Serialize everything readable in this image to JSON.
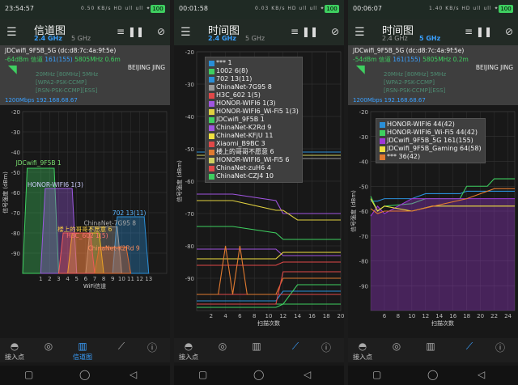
{
  "panels": [
    {
      "status": {
        "time": "23:54:57",
        "mid": "0.50 KB/s  HD  ull  ull  ✦",
        "battery": "100"
      },
      "title": "信道图",
      "tabs": [
        "2.4 GHz",
        "5 GHz"
      ],
      "active_tab": 0,
      "info": {
        "ssid": "JDCwifi_9F5B_5G (dc:d8:7c:4a:9f:5e)",
        "line2_a": "-64dBm  信道 ",
        "line2_b": "161(155)",
        "line2_c": "  5805MHz  0.6m",
        "vendor": "BEIJING JING",
        "l3": "20MHz  [80MHz]  5MHz",
        "l4": "[WPA2-PSK-CCMP]",
        "l5": "[RSN-PSK-CCMP][ESS]",
        "l6": "1200Mbps  192.168.68.67"
      },
      "nav": [
        {
          "label": "接入点",
          "icon": "wifi-icon"
        },
        {
          "label": "",
          "icon": "radar-icon"
        },
        {
          "label": "信道图",
          "icon": "bar-chart-icon"
        },
        {
          "label": "",
          "icon": "line-chart-icon"
        },
        {
          "label": "",
          "icon": "info-icon"
        }
      ],
      "active_nav": 2
    },
    {
      "status": {
        "time": "00:01:58",
        "mid": "0.03 KB/s  HD  ull  ull  ✦",
        "battery": "100"
      },
      "title": "时间图",
      "tabs": [
        "2.4 GHz",
        "5 GHz"
      ],
      "active_tab": 0,
      "nav": [
        {
          "label": "接入点",
          "icon": "wifi-icon"
        },
        {
          "label": "",
          "icon": "radar-icon"
        },
        {
          "label": "",
          "icon": "bar-chart-icon"
        },
        {
          "label": "",
          "icon": "line-chart-icon"
        },
        {
          "label": "",
          "icon": "info-icon"
        }
      ],
      "active_nav": 3
    },
    {
      "status": {
        "time": "00:06:07",
        "mid": "1.40 KB/s  HD  ull  ull  ✦",
        "battery": "100"
      },
      "title": "时间图",
      "tabs": [
        "2.4 GHz",
        "5 GHz"
      ],
      "active_tab": 1,
      "info": {
        "ssid": "JDCwifi_9F5B_5G (dc:d8:7c:4a:9f:5e)",
        "line2_a": "-54dBm  信道 ",
        "line2_b": "161(155)",
        "line2_c": "  5805MHz  0.2m",
        "vendor": "BEIJING JING",
        "l3": "20MHz  [80MHz]  5MHz",
        "l4": "[WPA2-PSK-CCMP]",
        "l5": "[RSN-PSK-CCMP][ESS]",
        "l6": "1200Mbps  192.168.68.67"
      },
      "nav": [
        {
          "label": "接入点",
          "icon": "wifi-icon"
        },
        {
          "label": "",
          "icon": "radar-icon"
        },
        {
          "label": "",
          "icon": "bar-chart-icon"
        },
        {
          "label": "",
          "icon": "line-chart-icon"
        },
        {
          "label": "",
          "icon": "info-icon"
        }
      ],
      "active_nav": 3
    }
  ],
  "chart_data": [
    {
      "type": "area",
      "ylabel": "信号强度 (dBm)",
      "xlabel": "WiFi信道",
      "ylim": [
        -100,
        -20
      ],
      "yticks": [
        -20,
        -30,
        -40,
        -50,
        -60,
        -70,
        -80,
        -90
      ],
      "xticks": [
        1,
        2,
        3,
        4,
        5,
        6,
        7,
        8,
        9,
        10,
        11,
        12,
        13
      ],
      "xlim": [
        -1,
        15
      ],
      "series": [
        {
          "name": "JDCwifi_9F5B 1",
          "center": 1,
          "level": -48,
          "color": "#3ecf60",
          "label_color": "#7ae070"
        },
        {
          "name": "HONOR-WIFI6 1(3)",
          "center": 3,
          "level": -58,
          "color": "#9b59e0",
          "label_color": "#d0d0ff"
        },
        {
          "name": "702 13(11)",
          "center": 11,
          "level": -72,
          "color": "#2a8fd8",
          "label_color": "#5ab6ff"
        },
        {
          "name": "ChinaNet-7G95 8",
          "center": 8,
          "level": -77,
          "color": "#9a9a9a",
          "label_color": "#aaaaaa"
        },
        {
          "name": "楼上的哥哥不愿意 6",
          "center": 6,
          "level": -80,
          "color": "#f0c020",
          "label_color": "#ffd040"
        },
        {
          "name": "H3C_602 1(5)",
          "center": 5,
          "level": -80,
          "color": "#f05a5a",
          "label_color": "#ff7070"
        },
        {
          "name": "ChinaNet-K2Rd 9",
          "center": 9,
          "level": -87,
          "color": "#e06a30",
          "label_color": "#ff9060"
        }
      ]
    },
    {
      "type": "line",
      "ylabel": "信号强度 (dBm)",
      "xlabel": "扫描次数",
      "ylim": [
        -100,
        -20
      ],
      "yticks": [
        -20,
        -30,
        -40,
        -50,
        -60,
        -70,
        -80,
        -90
      ],
      "xlim": [
        0,
        20
      ],
      "xticks": [
        2,
        4,
        6,
        8,
        10,
        12,
        14,
        16,
        18,
        20
      ],
      "legend_position": "top-left",
      "series": [
        {
          "name": "*** 1",
          "color": "#2a8fd8",
          "x": [
            0,
            11,
            12,
            14,
            20
          ],
          "y": [
            -97,
            -97,
            -94,
            -94,
            -94
          ]
        },
        {
          "name": "1002 6(8)",
          "color": "#3ecf60",
          "x": [
            0,
            12,
            14,
            20
          ],
          "y": [
            -98,
            -98,
            -92,
            -92
          ]
        },
        {
          "name": "702 13(11)",
          "color": "#2a8fd8",
          "x": [
            0,
            20
          ],
          "y": [
            -51,
            -51
          ]
        },
        {
          "name": "ChinaNet-7G95 8",
          "color": "#9a9a9a",
          "x": [
            0,
            20
          ],
          "y": [
            -53,
            -53
          ]
        },
        {
          "name": "H3C_602 1(5)",
          "color": "#e04848",
          "x": [
            0,
            20
          ],
          "y": [
            -95,
            -95
          ]
        },
        {
          "name": "HONOR-WIFI6 1(3)",
          "color": "#a055e0",
          "x": [
            0,
            5,
            11,
            12,
            14,
            20
          ],
          "y": [
            -64,
            -64,
            -66,
            -70,
            -70,
            -70
          ]
        },
        {
          "name": "HONOR-WIFI6_Wi-Fi5 1(3)",
          "color": "#e0d040",
          "x": [
            0,
            5,
            11,
            12,
            14,
            20
          ],
          "y": [
            -66,
            -66,
            -69,
            -69,
            -72,
            -72
          ]
        },
        {
          "name": "JDCwifi_9F5B 1",
          "color": "#3ecf60",
          "x": [
            0,
            5,
            11,
            12,
            14,
            20
          ],
          "y": [
            -74,
            -74,
            -76,
            -78,
            -78,
            -78
          ]
        },
        {
          "name": "ChinaNet-K2Rd 9",
          "color": "#a055e0",
          "x": [
            0,
            11,
            12,
            14,
            20
          ],
          "y": [
            -81,
            -81,
            -83,
            -83,
            -83
          ]
        },
        {
          "name": "ChinaNet-KFjU 11",
          "color": "#f0e040",
          "x": [
            0,
            5,
            11,
            12,
            14,
            20
          ],
          "y": [
            -84,
            -84,
            -84,
            -82,
            -82,
            -82
          ]
        },
        {
          "name": "Xiaomi_B9BC 3",
          "color": "#e04848",
          "x": [
            0,
            11,
            12,
            14,
            20
          ],
          "y": [
            -86,
            -86,
            -85,
            -85,
            -85
          ]
        },
        {
          "name": "楼上的哥哥不愿意 6",
          "color": "#e07a30",
          "x": [
            0,
            3,
            4,
            5,
            6,
            7,
            11,
            12,
            14,
            20
          ],
          "y": [
            -95,
            -95,
            -80,
            -95,
            -80,
            -95,
            -95,
            -90,
            -90,
            -90
          ]
        },
        {
          "name": "HONOR-WIFI6_Wi-Fi5 6",
          "color": "#d0d060",
          "x": [
            0,
            20
          ],
          "y": [
            -52,
            -52
          ]
        },
        {
          "name": "ChinaNet-zuH6 4",
          "color": "#e04848",
          "x": [
            0,
            11,
            12,
            14,
            20
          ],
          "y": [
            -98,
            -98,
            -88,
            -88,
            -88
          ]
        },
        {
          "name": "ChinaNet-CZJ4 10",
          "color": "#3ecf60",
          "x": [
            0,
            11,
            12,
            14,
            20
          ],
          "y": [
            -99,
            -99,
            -98,
            -98,
            -98
          ]
        }
      ]
    },
    {
      "type": "line",
      "ylabel": "信号强度 (dBm)",
      "xlabel": "扫描次数",
      "ylim": [
        -100,
        -20
      ],
      "yticks": [
        -20,
        -30,
        -40,
        -50,
        -60,
        -70,
        -80,
        -90
      ],
      "xlim": [
        4,
        25
      ],
      "xticks": [
        6,
        8,
        10,
        12,
        14,
        16,
        18,
        20,
        22,
        24
      ],
      "legend_position": "top-left",
      "series": [
        {
          "name": "HONOR-WIFI6 44(42)",
          "color": "#2a8fd8",
          "x": [
            4,
            5,
            6,
            10,
            12,
            17,
            18,
            25
          ],
          "y": [
            -56,
            -56,
            -55,
            -55,
            -53,
            -53,
            -52,
            -52
          ]
        },
        {
          "name": "HONOR-WIFI6_Wi-Fi5 44(42)",
          "color": "#3ecf60",
          "x": [
            4,
            5,
            6,
            10,
            12,
            17,
            18,
            21,
            22,
            25
          ],
          "y": [
            -54,
            -60,
            -58,
            -57,
            -55,
            -55,
            -50,
            -50,
            -47,
            -47
          ]
        },
        {
          "name": "JDCwifi_9F5B_5G 161(155)",
          "color": "#a038d8",
          "fill": true,
          "x": [
            4,
            5,
            6,
            10,
            25
          ],
          "y": [
            -62,
            -58,
            -61,
            -55,
            -55
          ]
        },
        {
          "name": "JDCwifi_9F5B_Gaming 64(58)",
          "color": "#f0e040",
          "x": [
            4,
            5,
            6,
            10,
            13,
            25
          ],
          "y": [
            -55,
            -60,
            -58,
            -60,
            -58,
            -58
          ]
        },
        {
          "name": "*** 36(42)",
          "color": "#e07a30",
          "x": [
            4,
            5,
            6,
            10,
            18,
            22,
            25
          ],
          "y": [
            -59,
            -61,
            -60,
            -60,
            -55,
            -51,
            -51
          ]
        }
      ]
    }
  ]
}
